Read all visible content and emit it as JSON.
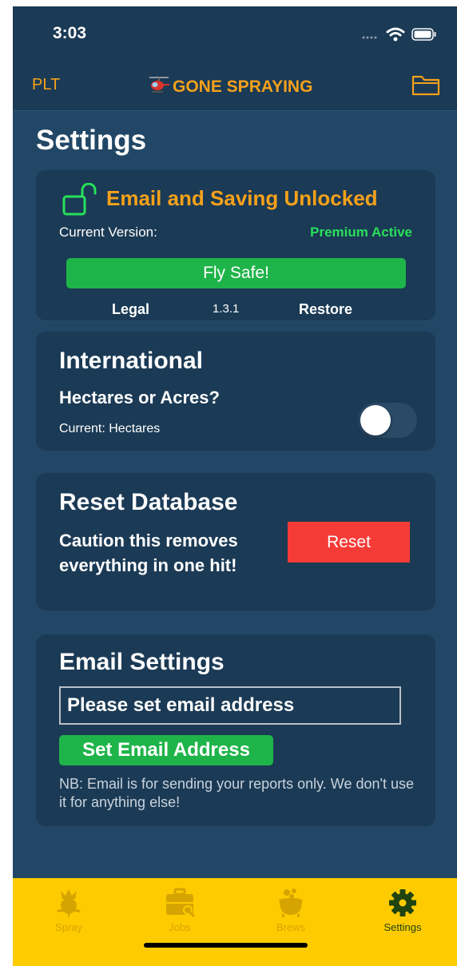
{
  "status_bar": {
    "time": "3:03",
    "icons": [
      "signal-icon",
      "wifi-icon",
      "battery-icon"
    ]
  },
  "nav": {
    "left": "PLT",
    "title": "GONE SPRAYING",
    "title_icon": "helicopter-icon",
    "right_icon": "folder-icon"
  },
  "page_title": "Settings",
  "premium_card": {
    "title": "Email and Saving Unlocked",
    "icon": "unlock-icon",
    "current_version_label": "Current Version:",
    "status": "Premium Active",
    "button": "Fly Safe!",
    "legal": "Legal",
    "version": "1.3.1",
    "restore": "Restore"
  },
  "international_card": {
    "title": "International",
    "question": "Hectares or Acres?",
    "current": "Current: Hectares",
    "toggle_on": false
  },
  "reset_card": {
    "title": "Reset Database",
    "warning_line1": "Caution this removes",
    "warning_line2": "everything in one hit!",
    "button": "Reset"
  },
  "email_card": {
    "title": "Email Settings",
    "input_placeholder": "Please set email address",
    "button": "Set Email Address",
    "note": "NB: Email is for sending your reports only. We don't use it for anything else!"
  },
  "tabs": [
    {
      "label": "Spray",
      "icon": "thistle-icon",
      "active": false
    },
    {
      "label": "Jobs",
      "icon": "briefcase-icon",
      "active": false
    },
    {
      "label": "Brews",
      "icon": "cauldron-icon",
      "active": false
    },
    {
      "label": "Settings",
      "icon": "gear-icon",
      "active": true
    }
  ],
  "colors": {
    "background": "#224766",
    "card": "#1b3a55",
    "accent_orange": "#f6a11a",
    "green": "#1fb44a",
    "premium_green": "#27e05a",
    "reset_red": "#f53b36",
    "tabbar_yellow": "#fecb00",
    "tab_inactive": "#d6a400",
    "tab_active": "#1f4410"
  }
}
